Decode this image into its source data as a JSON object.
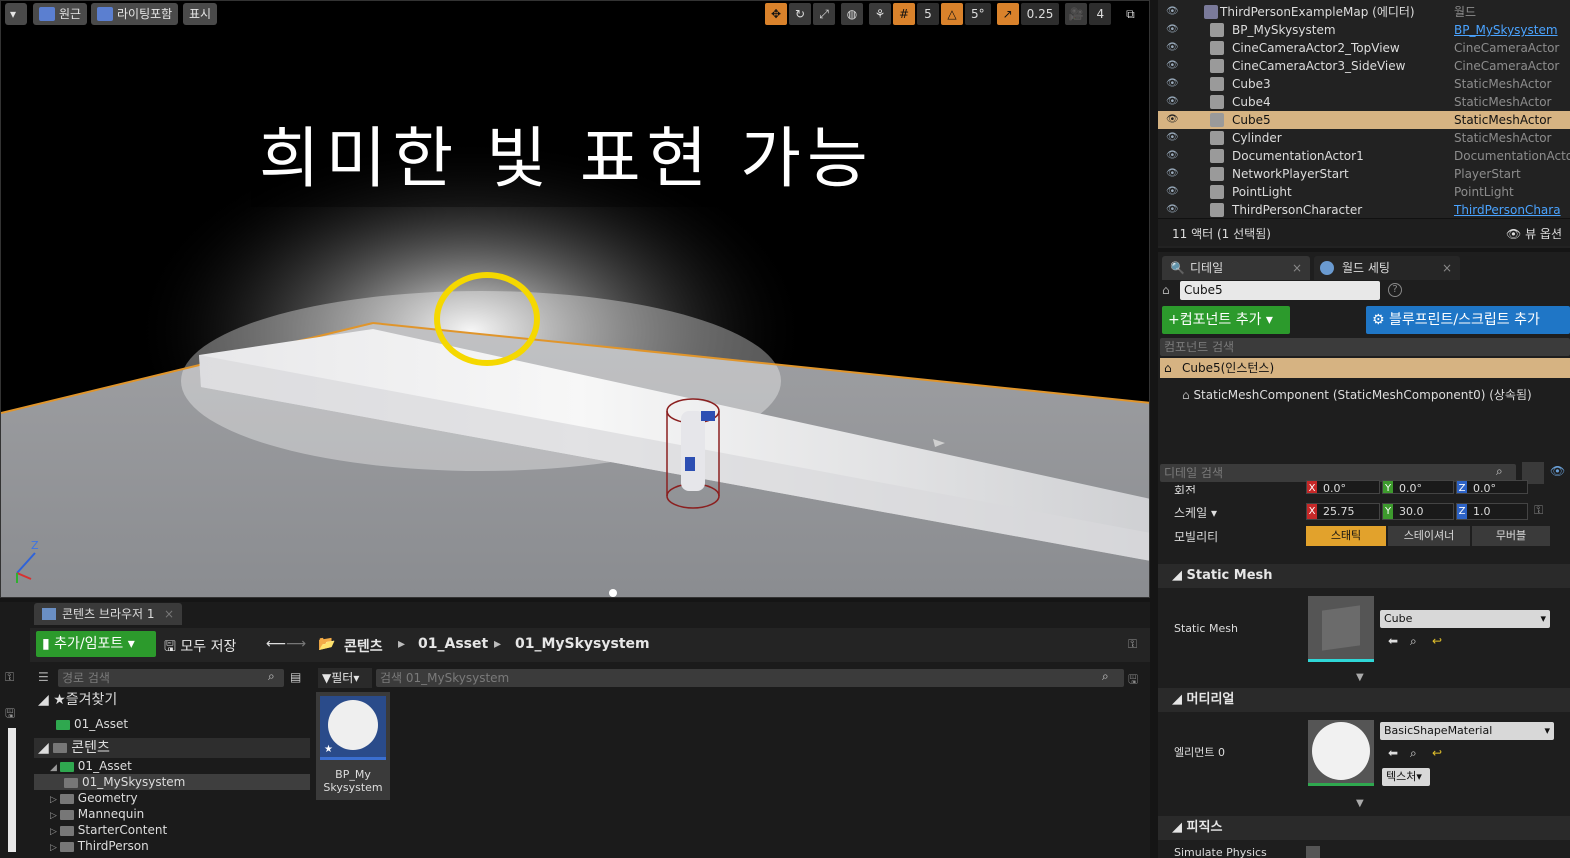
{
  "viewport": {
    "menu_button": "▾",
    "perspective_label": "원근",
    "lighting_label": "라이팅포함",
    "show_label": "표시",
    "grid_snap": "5",
    "angle_snap": "5°",
    "scale_snap": "0.25",
    "camera_speed": "4",
    "caption": "희미한 빛 표현 가능",
    "axis_z": "Z"
  },
  "outliner": {
    "rows": [
      {
        "name": "ThirdPersonExampleMap (에디터)",
        "type": "월드",
        "link": false
      },
      {
        "name": "BP_MySkysystem",
        "type": "BP_MySkysystem",
        "link": true
      },
      {
        "name": "CineCameraActor2_TopView",
        "type": "CineCameraActor",
        "link": false
      },
      {
        "name": "CineCameraActor3_SideView",
        "type": "CineCameraActor",
        "link": false
      },
      {
        "name": "Cube3",
        "type": "StaticMeshActor",
        "link": false
      },
      {
        "name": "Cube4",
        "type": "StaticMeshActor",
        "link": false
      },
      {
        "name": "Cube5",
        "type": "StaticMeshActor",
        "link": false,
        "selected": true
      },
      {
        "name": "Cylinder",
        "type": "StaticMeshActor",
        "link": false
      },
      {
        "name": "DocumentationActor1",
        "type": "DocumentationActo",
        "link": false
      },
      {
        "name": "NetworkPlayerStart",
        "type": "PlayerStart",
        "link": false
      },
      {
        "name": "PointLight",
        "type": "PointLight",
        "link": false
      },
      {
        "name": "ThirdPersonCharacter",
        "type": "ThirdPersonChara",
        "link": true
      }
    ],
    "status": "11 액터 (1 선택됨)",
    "view_options": "뷰 옵션"
  },
  "details": {
    "tab_details": "디테일",
    "tab_world": "월드 세팅",
    "actor_name": "Cube5",
    "add_component": "컴포넌트 추가",
    "blueprint_script": "블루프린트/스크립트 추가",
    "component_search": "컴포넌트 검색",
    "instance_label": "Cube5(인스턴스)",
    "component_label": "StaticMeshComponent (StaticMeshComponent0) (상속됨)",
    "detail_search": "디테일 검색",
    "rotation_label": "회전",
    "rotation": {
      "x": "0.0°",
      "y": "0.0°",
      "z": "0.0°"
    },
    "scale_label": "스케일",
    "scale": {
      "x": "25.75",
      "y": "30.0",
      "z": "1.0"
    },
    "mobility_label": "모빌리티",
    "mobility_static": "스태틱",
    "mobility_stationary": "스테이셔너",
    "mobility_movable": "무버블",
    "section_static_mesh": "Static Mesh",
    "static_mesh_label": "Static Mesh",
    "static_mesh_value": "Cube",
    "section_material": "머티리얼",
    "element_label": "엘리먼트 0",
    "material_value": "BasicShapeMaterial",
    "texture_button": "텍스처",
    "section_physics": "피직스",
    "simulate_physics": "Simulate Physics"
  },
  "content_browser": {
    "tab_title": "콘텐츠 브라우저 1",
    "add_import": "추가/임포트",
    "save_all": "모두 저장",
    "crumbs": [
      "콘텐츠",
      "01_Asset",
      "01_MySkysystem"
    ],
    "path_search": "경로 검색",
    "filter": "필터",
    "asset_search": "검색 01_MySkysystem",
    "favorites": "즐겨찾기",
    "fav_item": "01_Asset",
    "content_root": "콘텐츠",
    "tree": [
      {
        "name": "01_Asset",
        "green": true
      },
      {
        "name": "01_MySkysystem",
        "green": false,
        "selected": true
      },
      {
        "name": "Geometry",
        "green": false
      },
      {
        "name": "Mannequin",
        "green": false
      },
      {
        "name": "StarterContent",
        "green": false
      },
      {
        "name": "ThirdPerson",
        "green": false
      }
    ],
    "asset_name_1": "BP_My",
    "asset_name_2": "Skysystem"
  },
  "colors": {
    "accent_orange": "#d9822b",
    "selection": "#d6b382",
    "green": "#2c9a2c",
    "blue": "#1f76c6",
    "link": "#4aa3ff"
  }
}
